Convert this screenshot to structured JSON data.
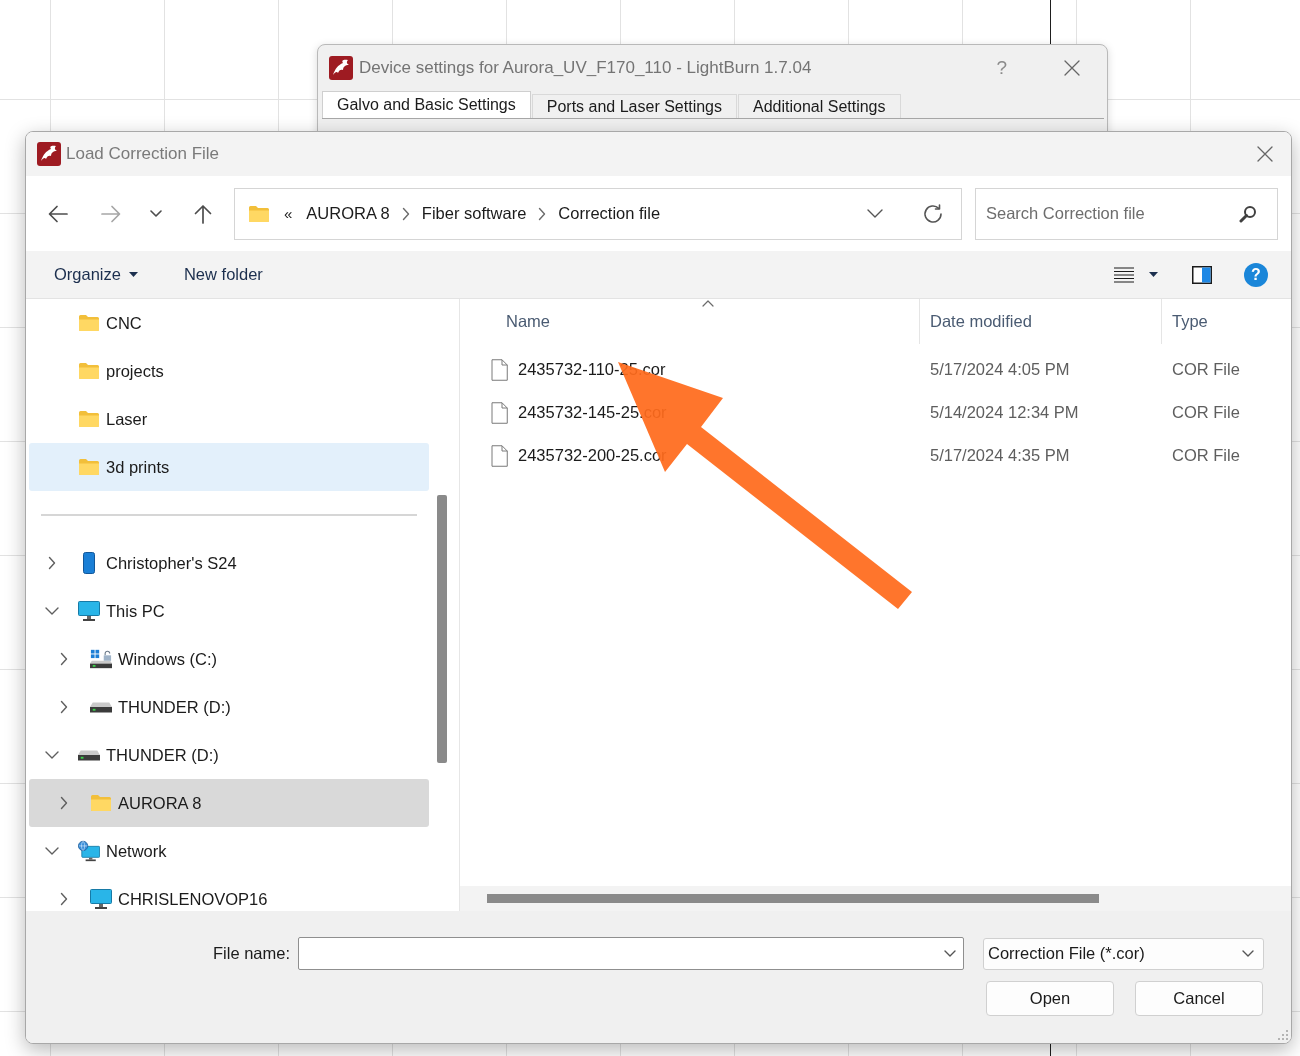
{
  "background_window": {
    "title": "Device settings for Aurora_UV_F170_110 - LightBurn 1.7.04",
    "help": "?",
    "tabs": [
      {
        "label": "Galvo and Basic Settings",
        "selected": true
      },
      {
        "label": "Ports and Laser Settings",
        "selected": false
      },
      {
        "label": "Additional Settings",
        "selected": false
      }
    ]
  },
  "dialog": {
    "title": "Load Correction File"
  },
  "navigation": {
    "buttons": [
      {
        "kind": "back",
        "disabled": false
      },
      {
        "kind": "forward",
        "disabled": true
      },
      {
        "kind": "recent",
        "disabled": false
      },
      {
        "kind": "up",
        "disabled": false
      }
    ]
  },
  "address_bar": {
    "overflow": "«",
    "path": [
      "AURORA 8",
      "Fiber software",
      "Correction file"
    ]
  },
  "search": {
    "placeholder": "Search Correction file"
  },
  "toolbar": {
    "items": [
      {
        "label": "Organize",
        "dropdown": true
      },
      {
        "label": "New folder",
        "dropdown": false
      }
    ],
    "help": "?"
  },
  "sidebar": {
    "pinned": [
      {
        "label": "CNC",
        "kind": "folder",
        "selected": false,
        "hovered": false
      },
      {
        "label": "projects",
        "kind": "folder",
        "selected": false,
        "hovered": false
      },
      {
        "label": "Laser",
        "kind": "folder",
        "selected": false,
        "hovered": false
      },
      {
        "label": "3d prints",
        "kind": "folder",
        "selected": false,
        "hovered": true
      }
    ],
    "tree": [
      {
        "label": "Christopher's S24",
        "kind": "phone",
        "expanded": false,
        "selected": false,
        "hovered": false
      },
      {
        "label": "This PC",
        "kind": "computer",
        "expanded": true,
        "selected": false,
        "hovered": false,
        "children": [
          {
            "label": "Windows (C:)",
            "kind": "system_drive",
            "expanded": false,
            "selected": false,
            "hovered": false
          },
          {
            "label": "THUNDER (D:)",
            "kind": "drive",
            "expanded": false,
            "selected": false,
            "hovered": false
          }
        ]
      },
      {
        "label": "THUNDER (D:)",
        "kind": "drive",
        "expanded": true,
        "selected": false,
        "hovered": false,
        "children": [
          {
            "label": "AURORA 8",
            "kind": "folder",
            "expanded": false,
            "selected": true,
            "hovered": false
          }
        ]
      },
      {
        "label": "Network",
        "kind": "network",
        "expanded": true,
        "selected": false,
        "hovered": false,
        "children": [
          {
            "label": "CHRISLENOVOP16",
            "kind": "computer",
            "expanded": false,
            "selected": false,
            "hovered": false
          }
        ]
      }
    ]
  },
  "file_list": {
    "columns": [
      {
        "label": "Name",
        "sorted": true
      },
      {
        "label": "Date modified",
        "sorted": false
      },
      {
        "label": "Type",
        "sorted": false
      }
    ],
    "rows": [
      {
        "name": "2435732-110-25.cor",
        "date_modified": "5/17/2024 4:05 PM",
        "type": "COR File"
      },
      {
        "name": "2435732-145-25.cor",
        "date_modified": "5/14/2024 12:34 PM",
        "type": "COR File"
      },
      {
        "name": "2435732-200-25.cor",
        "date_modified": "5/17/2024 4:35 PM",
        "type": "COR File"
      }
    ]
  },
  "footer": {
    "file_name_label": "File name:",
    "file_type": "Correction File (*.cor)",
    "buttons": [
      "Open",
      "Cancel"
    ]
  }
}
